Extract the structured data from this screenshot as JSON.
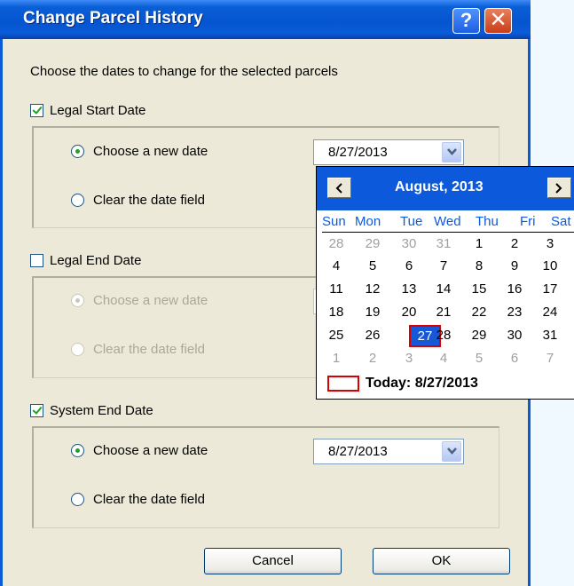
{
  "dialog": {
    "title": "Change Parcel History",
    "help_glyph": "?",
    "close_glyph": "✕",
    "instruction": "Choose the dates to change for the selected parcels"
  },
  "sections": [
    {
      "label": "Legal Start Date",
      "checked": true,
      "option_new": "Choose a new date",
      "option_clear": "Clear the date field",
      "selected": "new",
      "date_value": "8/27/2013"
    },
    {
      "label": "Legal End Date",
      "checked": false,
      "option_new": "Choose a new date",
      "option_clear": "Clear the date field",
      "selected": "new",
      "disabled": true
    },
    {
      "label": "System End Date",
      "checked": true,
      "option_new": "Choose a new date",
      "option_clear": "Clear the date field",
      "selected": "new",
      "date_value": "8/27/2013"
    }
  ],
  "buttons": {
    "cancel": "Cancel",
    "ok": "OK"
  },
  "calendar": {
    "title": "August, 2013",
    "weekdays": [
      "Sun",
      "Mon",
      "Tue",
      "Wed",
      "Thu",
      "Fri",
      "Sat"
    ],
    "weeks": [
      [
        "28",
        "29",
        "30",
        "31",
        "1",
        "2",
        "3"
      ],
      [
        "4",
        "5",
        "6",
        "7",
        "8",
        "9",
        "10"
      ],
      [
        "11",
        "12",
        "13",
        "14",
        "15",
        "16",
        "17"
      ],
      [
        "18",
        "19",
        "20",
        "21",
        "22",
        "23",
        "24"
      ],
      [
        "25",
        "26",
        "27",
        "28",
        "29",
        "30",
        "31"
      ],
      [
        "1",
        "2",
        "3",
        "4",
        "5",
        "6",
        "7"
      ]
    ],
    "selected_day": "27",
    "today_label": "Today: 8/27/2013"
  },
  "colors": {
    "titlebar": "#0555d0",
    "calendar_header": "#0c5adb",
    "today_border": "#d90000",
    "weekday_text": "#0c5adb",
    "dialog_background": "#ece9d8"
  }
}
